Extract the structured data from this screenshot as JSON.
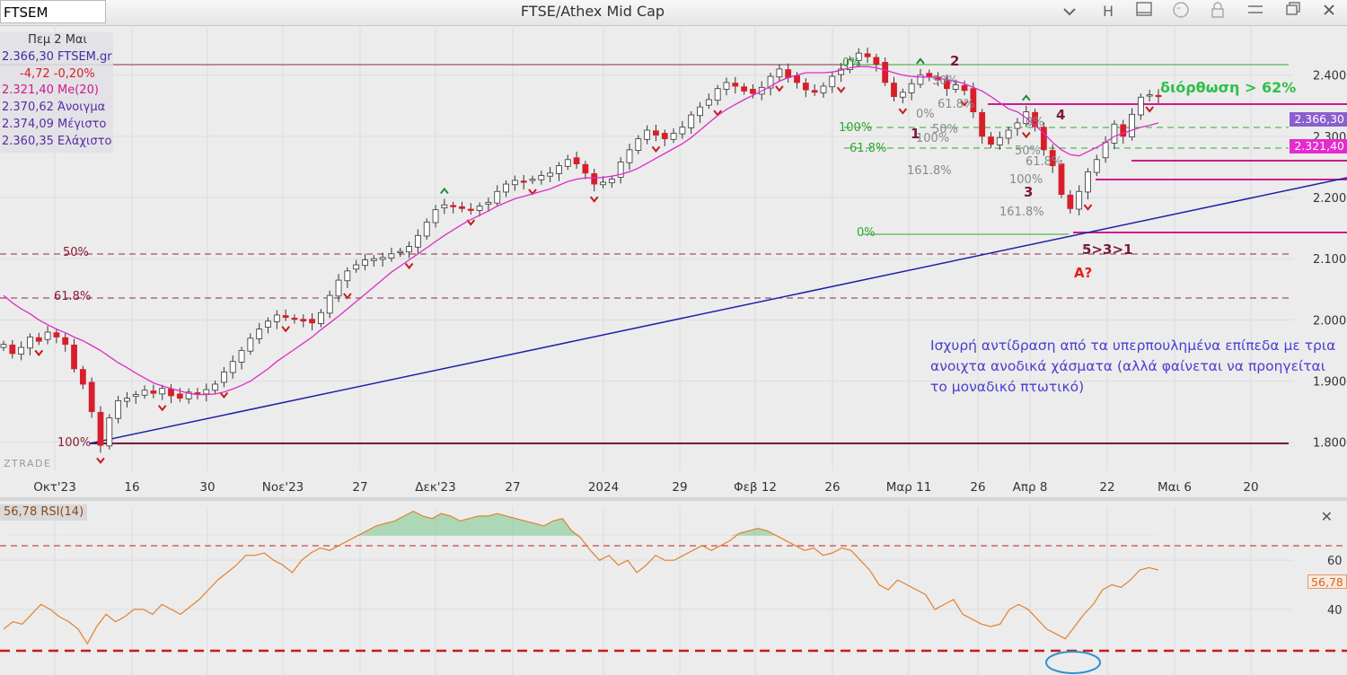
{
  "toolbar": {
    "symbol": "FTSEM",
    "title": "FTSE/Athex Mid Cap",
    "icons": [
      "chevron-down-icon",
      "h-letter-icon",
      "panel-icon",
      "chat-icon",
      "lock-icon",
      "menu-icon",
      "restore-icon",
      "close-icon"
    ],
    "h_label": "H"
  },
  "info": {
    "date": "Πεμ 2 Μαι",
    "last": "2.366,30 FTSEM.gr",
    "change": "-4,72 -0,20%",
    "ma": "2.321,40 Me(20)",
    "open": "2.370,62 Άνοιγμα",
    "high": "2.374,09 Μέγιστο",
    "low": "2.360,35 Ελάχιστο"
  },
  "price_badges": {
    "last": "2.366,30",
    "ma": "2.321,40"
  },
  "rsi": {
    "label": "56,78 RSI(14)",
    "badge": "56,78",
    "close": "✕"
  },
  "watermark": "ZTRADE",
  "annotation_text": "Ισχυρή αντίδραση από τα υπερπουλημένα επίπεδα με τρια ανοιχτα ανοδικά χάσματα (αλλά φαίνεται να προηγείται το μοναδικό πτωτικό)",
  "colors": {
    "up": "#ffffff",
    "down": "#d81e2a",
    "ma": "#e02ac8",
    "trend": "#1f1fa8",
    "rsi": "#e2812e",
    "fib": "#2fa82f"
  },
  "chart_data": [
    {
      "type": "candlestick",
      "title": "FTSE/Athex Mid Cap",
      "x_ticks": [
        "Οκτ'23",
        "16",
        "30",
        "Νοε'23",
        "27",
        "Δεκ'23",
        "27",
        "2024",
        "29",
        "Φεβ 12",
        "26",
        "Μαρ 11",
        "26",
        "Απρ 8",
        "22",
        "Μαι 6",
        "20"
      ],
      "y_ticks": [
        "2.400",
        "2.300",
        "2.200",
        "2.100",
        "2.000",
        "1.900",
        "1.800"
      ],
      "ylim": [
        1760,
        2470
      ],
      "series": [
        {
          "name": "FTSEM.gr",
          "values": [
            1960,
            1945,
            1955,
            1972,
            1965,
            1980,
            1972,
            1960,
            1920,
            1895,
            1850,
            1795,
            1840,
            1868,
            1872,
            1878,
            1885,
            1880,
            1888,
            1876,
            1872,
            1882,
            1880,
            1886,
            1895,
            1915,
            1932,
            1950,
            1970,
            1985,
            1998,
            2008,
            2004,
            2002,
            1998,
            1995,
            2012,
            2040,
            2065,
            2080,
            2090,
            2098,
            2100,
            2102,
            2108,
            2112,
            2120,
            2138,
            2160,
            2180,
            2188,
            2186,
            2182,
            2180,
            2186,
            2192,
            2210,
            2222,
            2228,
            2225,
            2230,
            2236,
            2240,
            2252,
            2262,
            2255,
            2240,
            2222,
            2225,
            2230,
            2258,
            2278,
            2296,
            2310,
            2302,
            2296,
            2305,
            2315,
            2335,
            2348,
            2360,
            2378,
            2388,
            2382,
            2374,
            2370,
            2380,
            2398,
            2410,
            2396,
            2388,
            2376,
            2372,
            2382,
            2398,
            2410,
            2425,
            2436,
            2430,
            2418,
            2388,
            2365,
            2372,
            2386,
            2400,
            2398,
            2392,
            2378,
            2384,
            2375,
            2340,
            2300,
            2287,
            2298,
            2310,
            2322,
            2340,
            2316,
            2278,
            2252,
            2205,
            2182,
            2210,
            2242,
            2262,
            2290,
            2320,
            2300,
            2336,
            2364,
            2368,
            2366
          ]
        },
        {
          "name": "Me(20)",
          "values": [
            2040,
            2028,
            2018,
            2010,
            2000,
            1992,
            1985,
            1979,
            1972,
            1966,
            1958,
            1950,
            1940,
            1930,
            1922,
            1913,
            1905,
            1897,
            1892,
            1888,
            1884,
            1880,
            1878,
            1878,
            1879,
            1882,
            1887,
            1893,
            1900,
            1910,
            1920,
            1932,
            1942,
            1952,
            1962,
            1972,
            1984,
            1995,
            2006,
            2018,
            2030,
            2042,
            2054,
            2066,
            2078,
            2088,
            2098,
            2108,
            2118,
            2128,
            2138,
            2147,
            2156,
            2164,
            2171,
            2178,
            2186,
            2192,
            2198,
            2202,
            2206,
            2210,
            2214,
            2220,
            2226,
            2230,
            2232,
            2232,
            2233,
            2235,
            2238,
            2242,
            2248,
            2256,
            2264,
            2272,
            2280,
            2288,
            2298,
            2310,
            2322,
            2334,
            2344,
            2352,
            2360,
            2367,
            2374,
            2382,
            2390,
            2396,
            2400,
            2404,
            2404,
            2404,
            2405,
            2408,
            2412,
            2414,
            2414,
            2412,
            2408,
            2404,
            2400,
            2398,
            2397,
            2397,
            2396,
            2392,
            2390,
            2386,
            2380,
            2374,
            2365,
            2355,
            2345,
            2340,
            2330,
            2318,
            2305,
            2290,
            2278,
            2270,
            2268,
            2275,
            2282,
            2290,
            2300,
            2305,
            2310,
            2315,
            2318,
            2322
          ]
        }
      ],
      "horizontal_levels": [
        1800,
        2130,
        2170,
        2250,
        2283,
        2310,
        2335,
        2370,
        2445
      ],
      "trendline": [
        {
          "x": "2023-10-11",
          "y": 1800
        },
        {
          "x": "2024-05-26",
          "y": 2250
        }
      ],
      "fib_labels": [
        "100%",
        "61.8%",
        "50%",
        "0%",
        "100%",
        "61.8%",
        "50%",
        "0%",
        "100%",
        "161.8%",
        "0%",
        "50%",
        "61.8%",
        "100%",
        "161.8%",
        "61.8%",
        "50%",
        "0%"
      ],
      "wave_labels": [
        "1",
        "2",
        "3",
        "4",
        "5>3>1",
        "A?"
      ],
      "annotations": [
        "διόρθωση > 62%"
      ]
    },
    {
      "type": "line",
      "title": "RSI(14)",
      "y_ticks": [
        "60",
        "40"
      ],
      "ylim": [
        14,
        82
      ],
      "levels": [
        70,
        30
      ],
      "series": [
        {
          "name": "RSI(14)",
          "values": [
            32,
            35,
            34,
            38,
            42,
            40,
            37,
            35,
            32,
            26,
            33,
            38,
            35,
            37,
            40,
            40,
            38,
            42,
            40,
            38,
            41,
            44,
            48,
            52,
            55,
            58,
            62,
            62,
            63,
            60,
            58,
            55,
            60,
            63,
            65,
            64,
            66,
            68,
            70,
            72,
            74,
            75,
            76,
            78,
            80,
            78,
            77,
            79,
            78,
            76,
            77,
            78,
            78,
            79,
            78,
            77,
            76,
            75,
            74,
            76,
            77,
            72,
            69,
            64,
            60,
            62,
            58,
            60,
            55,
            58,
            62,
            60,
            60,
            62,
            64,
            66,
            64,
            66,
            68,
            71,
            72,
            73,
            72,
            70,
            68,
            66,
            64,
            65,
            62,
            63,
            65,
            64,
            60,
            56,
            50,
            48,
            52,
            50,
            48,
            46,
            40,
            42,
            44,
            38,
            36,
            34,
            33,
            34,
            40,
            42,
            40,
            36,
            32,
            30,
            28,
            33,
            38,
            42,
            48,
            50,
            49,
            52,
            56,
            57,
            56
          ]
        }
      ],
      "annotations": [
        "oversold-ellipse"
      ]
    }
  ]
}
